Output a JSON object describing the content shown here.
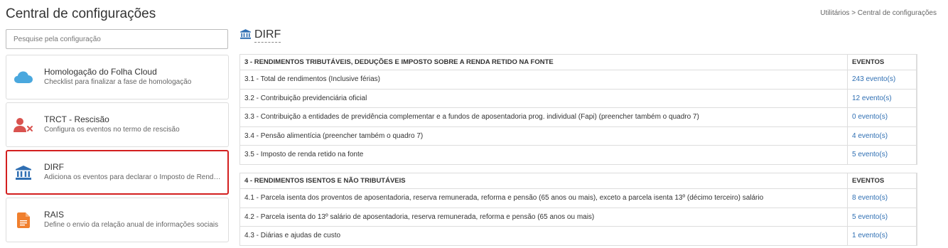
{
  "header": {
    "title": "Central de configurações",
    "breadcrumb": "Utilitários > Central de configurações"
  },
  "search": {
    "placeholder": "Pesquise pela configuração",
    "value": ""
  },
  "cards": [
    {
      "title": "Homologação do Folha Cloud",
      "subtitle": "Checklist para finalizar a fase de homologação",
      "icon": "cloud-icon",
      "color": "#4aa8de"
    },
    {
      "title": "TRCT - Rescisão",
      "subtitle": "Configura os eventos no termo de rescisão",
      "icon": "user-remove-icon",
      "color": "#d9534f"
    },
    {
      "title": "DIRF",
      "subtitle": "Adiciona os eventos para declarar o Imposto de Renda Retido na Fonte",
      "icon": "bank-icon",
      "color": "#2f6fb3",
      "selected": true
    },
    {
      "title": "RAIS",
      "subtitle": "Define o envio da relação anual de informações sociais",
      "icon": "document-icon",
      "color": "#f07f2d"
    }
  ],
  "section": {
    "title": "DIRF",
    "icon": "bank-icon"
  },
  "tables": [
    {
      "header": "3 - RENDIMENTOS TRIBUTÁVEIS, DEDUÇÕES E IMPOSTO SOBRE A RENDA RETIDO NA FONTE",
      "events_header": "EVENTOS",
      "rows": [
        {
          "label": "3.1 - Total de rendimentos (Inclusive férias)",
          "events": "243 evento(s)"
        },
        {
          "label": "3.2 - Contribuição previdenciária oficial",
          "events": "12 evento(s)"
        },
        {
          "label": "3.3 - Contribuição a entidades de previdência complementar e a fundos de aposentadoria prog. individual (Fapi) (preencher também o quadro 7)",
          "events": "0 evento(s)"
        },
        {
          "label": "3.4 - Pensão alimentícia (preencher também o quadro 7)",
          "events": "4 evento(s)"
        },
        {
          "label": "3.5 - Imposto de renda retido na fonte",
          "events": "5 evento(s)"
        }
      ]
    },
    {
      "header": "4 - RENDIMENTOS ISENTOS E NÃO TRIBUTÁVEIS",
      "events_header": "EVENTOS",
      "rows": [
        {
          "label": "4.1 - Parcela isenta dos proventos de aposentadoria, reserva remunerada, reforma e pensão (65 anos ou mais), exceto a parcela isenta 13º (décimo terceiro) salário",
          "events": "8 evento(s)"
        },
        {
          "label": "4.2 - Parcela isenta do 13º salário de aposentadoria, reserva remunerada, reforma e pensão (65 anos ou mais)",
          "events": "5 evento(s)"
        },
        {
          "label": "4.3 - Diárias e ajudas de custo",
          "events": "1 evento(s)"
        }
      ]
    }
  ],
  "row_menu_glyph": "⋮"
}
